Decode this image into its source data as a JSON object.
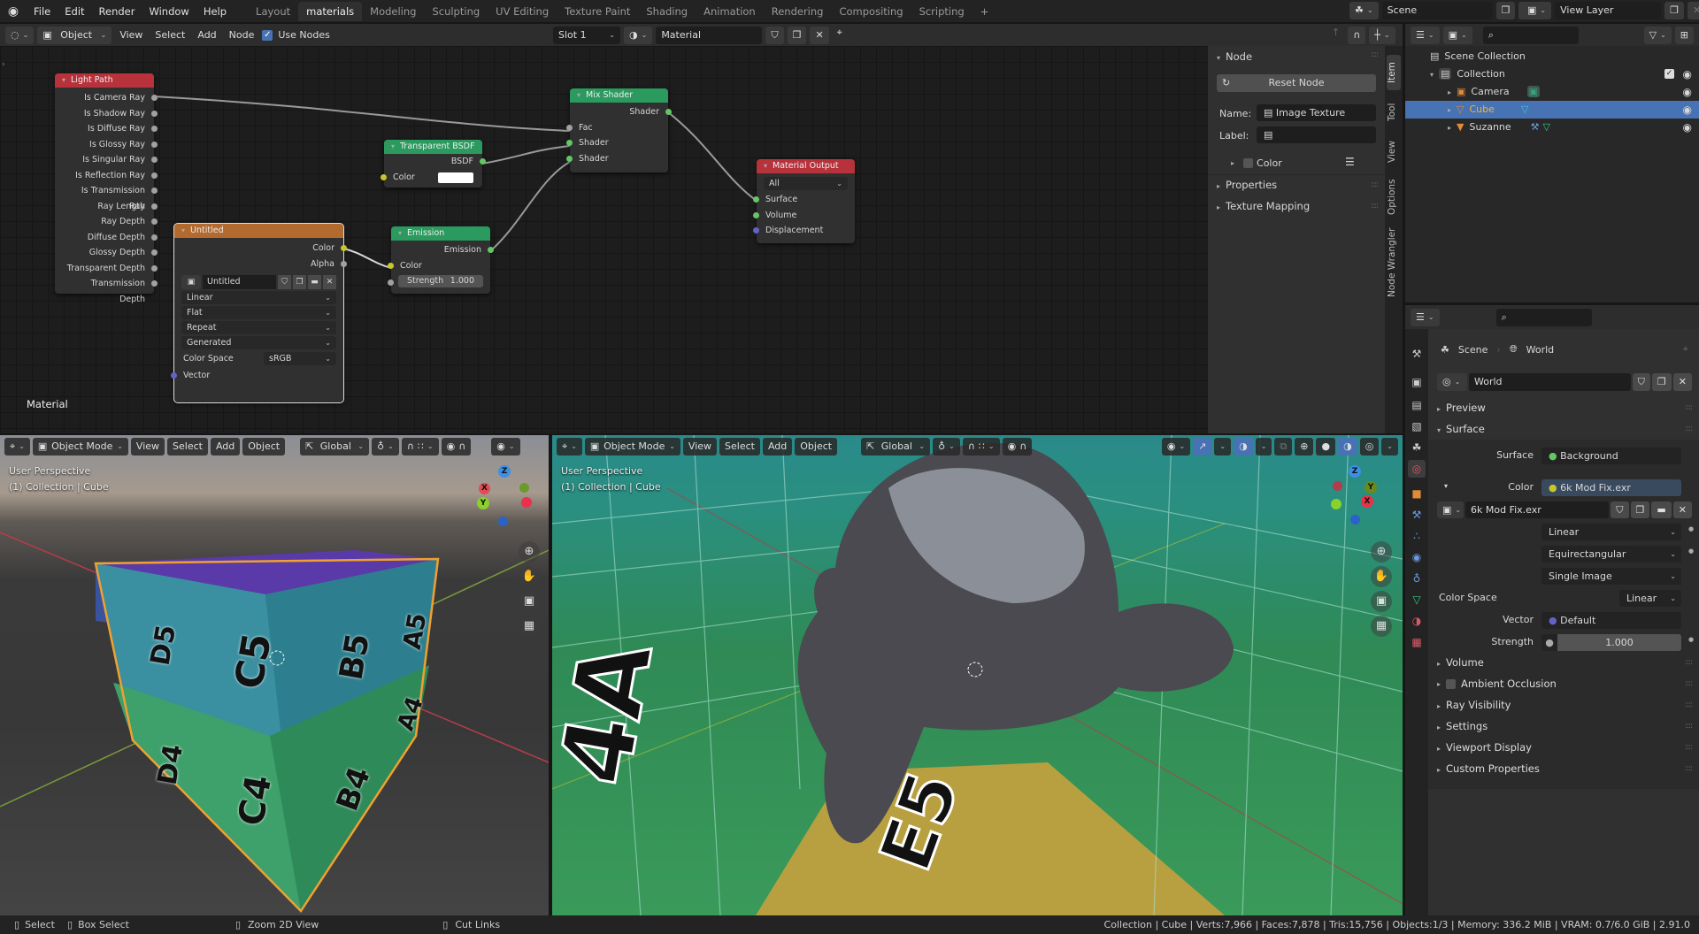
{
  "topbar": {
    "menus": [
      "File",
      "Edit",
      "Render",
      "Window",
      "Help"
    ],
    "workspaces": [
      "Layout",
      "materials",
      "Modeling",
      "Sculpting",
      "UV Editing",
      "Texture Paint",
      "Shading",
      "Animation",
      "Rendering",
      "Compositing",
      "Scripting"
    ],
    "active_workspace": "materials",
    "add_tab": "+",
    "scene": "Scene",
    "view_layer": "View Layer"
  },
  "node_header": {
    "editor_type": "Object",
    "menus": [
      "View",
      "Select",
      "Add",
      "Node"
    ],
    "use_nodes_label": "Use Nodes",
    "use_nodes_checked": true,
    "slot": "Slot 1",
    "material": "Material"
  },
  "node_editor": {
    "tree_label": "Material",
    "nodes": {
      "light_path": {
        "title": "Light Path",
        "outputs": [
          "Is Camera Ray",
          "Is Shadow Ray",
          "Is Diffuse Ray",
          "Is Glossy Ray",
          "Is Singular Ray",
          "Is Reflection Ray",
          "Is Transmission Ray",
          "Ray Length",
          "Ray Depth",
          "Diffuse Depth",
          "Glossy Depth",
          "Transparent Depth",
          "Transmission Depth"
        ]
      },
      "image_texture": {
        "title": "Untitled",
        "outputs": [
          "Color",
          "Alpha"
        ],
        "image_name": "Untitled",
        "interpolation": "Linear",
        "projection": "Flat",
        "extension": "Repeat",
        "source": "Generated",
        "color_space_label": "Color Space",
        "color_space": "sRGB",
        "input": "Vector"
      },
      "transparent_bsdf": {
        "title": "Transparent BSDF",
        "output": "BSDF",
        "input": "Color",
        "color": "#ffffff"
      },
      "emission": {
        "title": "Emission",
        "output": "Emission",
        "inputs": [
          "Color"
        ],
        "strength_label": "Strength",
        "strength": "1.000"
      },
      "mix_shader": {
        "title": "Mix Shader",
        "output": "Shader",
        "inputs": [
          "Fac",
          "Shader",
          "Shader"
        ]
      },
      "material_output": {
        "title": "Material Output",
        "target": "All",
        "inputs": [
          "Surface",
          "Volume",
          "Displacement"
        ]
      }
    }
  },
  "sidebar": {
    "node_panel": "Node",
    "reset_node": "Reset Node",
    "name_label": "Name:",
    "name_value": "Image Texture",
    "label_label": "Label:",
    "label_value": "",
    "color_label": "Color",
    "properties": "Properties",
    "texture_mapping": "Texture Mapping",
    "tabs": [
      "Item",
      "Tool",
      "View",
      "Options",
      "Node Wrangler"
    ]
  },
  "outliner": {
    "root": "Scene Collection",
    "collection": "Collection",
    "items": [
      {
        "name": "Camera",
        "selected": false
      },
      {
        "name": "Cube",
        "selected": true
      },
      {
        "name": "Suzanne",
        "selected": false
      }
    ]
  },
  "properties": {
    "breadcrumb": [
      "Scene",
      "World"
    ],
    "world_name": "World",
    "panels_top": [
      "Preview",
      "Surface"
    ],
    "surface_label": "Surface",
    "surface_value": "Background",
    "color_label": "Color",
    "color_value": "6k Mod Fix.exr",
    "image_name": "6k Mod Fix.exr",
    "interpolation": "Linear",
    "projection": "Equirectangular",
    "source": "Single Image",
    "color_space_label": "Color Space",
    "color_space": "Linear",
    "vector_label": "Vector",
    "vector_value": "Default",
    "strength_label": "Strength",
    "strength_value": "1.000",
    "panels_bottom": [
      "Volume",
      "Ambient Occlusion",
      "Ray Visibility",
      "Settings",
      "Viewport Display",
      "Custom Properties"
    ]
  },
  "viewport_left": {
    "mode": "Object Mode",
    "menus": [
      "View",
      "Select",
      "Add",
      "Object"
    ],
    "orientation": "Global",
    "perspective": "User Perspective",
    "context": "(1) Collection | Cube",
    "cube_labels": [
      "D5",
      "C5",
      "B5",
      "A5",
      "D4",
      "C4",
      "B4",
      "A4"
    ]
  },
  "viewport_right": {
    "mode": "Object Mode",
    "menus": [
      "View",
      "Select",
      "Add",
      "Object"
    ],
    "orientation": "Global",
    "perspective": "User Perspective",
    "context": "(1) Collection | Cube"
  },
  "gizmo": {
    "x": "X",
    "y": "Y",
    "z": "Z"
  },
  "status_bar": {
    "hints": [
      "Select",
      "Box Select",
      "Zoom 2D View",
      "Cut Links"
    ],
    "stats": "Collection | Cube | Verts:7,966 | Faces:7,878 | Tris:15,756 | Objects:1/3 | Memory: 336.2 MiB | VRAM: 0.7/6.0 GiB | 2.91.0"
  },
  "colors": {
    "accent_blue": "#4772b3",
    "selected_orange": "#f0a030",
    "node_input_red": "#b8323b",
    "node_shader_green": "#2a9a5f",
    "node_texture_orange": "#b36a2e"
  }
}
